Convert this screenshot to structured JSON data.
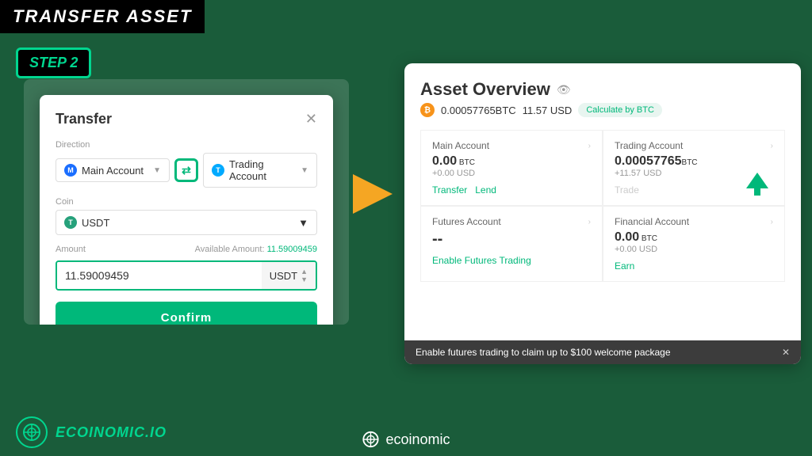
{
  "header": {
    "title": "TRANSFER ASSET"
  },
  "step": {
    "label": "STEP 2"
  },
  "transfer_dialog": {
    "title": "Transfer",
    "direction_label": "Direction",
    "from_account": "Main Account",
    "to_account": "Trading Account",
    "coin_label": "Coin",
    "coin": "USDT",
    "amount_label": "Amount",
    "available_label": "Available Amount:",
    "available_value": "11.59009459",
    "amount_value": "11.59009459",
    "amount_currency": "USDT",
    "confirm_label": "Confirm"
  },
  "asset_overview": {
    "title": "Asset Overview",
    "btc_balance": "0.00057765BTC",
    "usd_balance": "11.57 USD",
    "calculate_btn": "Calculate by BTC",
    "main_account": {
      "title": "Main Account",
      "balance": "0.00",
      "balance_currency": "BTC",
      "usd": "+0.00 USD",
      "actions": [
        "Transfer",
        "Lend"
      ]
    },
    "trading_account": {
      "title": "Trading Account",
      "balance": "0.00057765",
      "balance_currency": "BTC",
      "usd": "+11.57 USD",
      "actions": [
        "Trade"
      ]
    },
    "futures_account": {
      "title": "Futures Account",
      "balance": "--",
      "enable_link": "Enable Futures Trading"
    },
    "financial_account": {
      "title": "Financial Account",
      "balance": "0.00",
      "balance_currency": "BTC",
      "usd": "+0.00 USD",
      "actions": [
        "Earn"
      ]
    },
    "notification": "Enable futures trading to claim up to $100 welcome package"
  },
  "footer": {
    "brand_left": "ECOINOMIC.IO",
    "brand_right": "ecoinomic"
  }
}
